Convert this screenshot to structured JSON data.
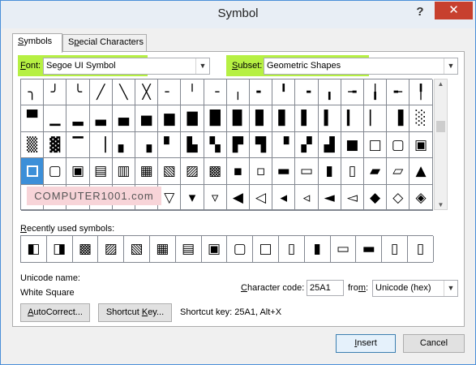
{
  "window": {
    "title": "Symbol",
    "help": "?",
    "close": "✕"
  },
  "tabs": [
    {
      "label_pre": "",
      "label_u": "S",
      "label_post": "ymbols"
    },
    {
      "label_pre": "S",
      "label_u": "p",
      "label_post": "ecial Characters"
    }
  ],
  "font": {
    "label_u": "F",
    "label_post": "ont:",
    "value": "Segoe UI Symbol"
  },
  "subset": {
    "label_u": "S",
    "label_post": "ubset:",
    "value": "Geometric Shapes"
  },
  "grid_rows": [
    [
      "╮",
      "╯",
      "╰",
      "╱",
      "╲",
      "╳",
      "╴",
      "╵",
      "╶",
      "╷",
      "╸",
      "╹",
      "╺",
      "╻",
      "╼",
      "╽",
      "╾",
      "╿"
    ],
    [
      "▀",
      "▁",
      "▂",
      "▃",
      "▄",
      "▅",
      "▆",
      "▇",
      "█",
      "▉",
      "▊",
      "▋",
      "▌",
      "▍",
      "▎",
      "▏",
      "▐",
      "░"
    ],
    [
      "▒",
      "▓",
      "▔",
      "▕",
      "▖",
      "▗",
      "▘",
      "▙",
      "▚",
      "▛",
      "▜",
      "▝",
      "▞",
      "▟",
      "■",
      "□",
      "▢",
      "▣"
    ],
    [
      "□",
      "▢",
      "▣",
      "▤",
      "▥",
      "▦",
      "▧",
      "▨",
      "▩",
      "▪",
      "▫",
      "▬",
      "▭",
      "▮",
      "▯",
      "▰",
      "▱",
      "▲"
    ],
    [
      "►",
      "▸",
      "▹",
      "►",
      "▻",
      "▼",
      "▽",
      "▾",
      "▿",
      "◀",
      "◁",
      "◂",
      "◃",
      "◄",
      "◅",
      "◆",
      "◇",
      "◈"
    ]
  ],
  "watermark": "COMPUTER1001.com",
  "recent": {
    "label_u": "R",
    "label_post": "ecently used symbols:",
    "items": [
      "◧",
      "◨",
      "▩",
      "▨",
      "▧",
      "▦",
      "▤",
      "▣",
      "▢",
      "□",
      "▯",
      "▮",
      "▭",
      "▬",
      "▯",
      "▯"
    ]
  },
  "unicode": {
    "name_label": "Unicode name:",
    "name_value": "White Square"
  },
  "charcode": {
    "label_u": "C",
    "label_post": "haracter code:",
    "value": "25A1"
  },
  "from": {
    "label_pre": "fro",
    "label_u": "m",
    "label_post": ":",
    "value": "Unicode (hex)"
  },
  "buttons": {
    "autocorrect": {
      "pre": "",
      "u": "A",
      "post": "utoCorrect..."
    },
    "shortcut": {
      "pre": "Shortcut ",
      "u": "K",
      "post": "ey..."
    },
    "shortcut_text": "Shortcut key: 25A1, Alt+X",
    "insert": {
      "u": "I",
      "post": "nsert"
    },
    "cancel": "Cancel"
  },
  "colors": {
    "highlight": "#b6f043",
    "close": "#c7402e",
    "selection": "#3c8fd8"
  }
}
